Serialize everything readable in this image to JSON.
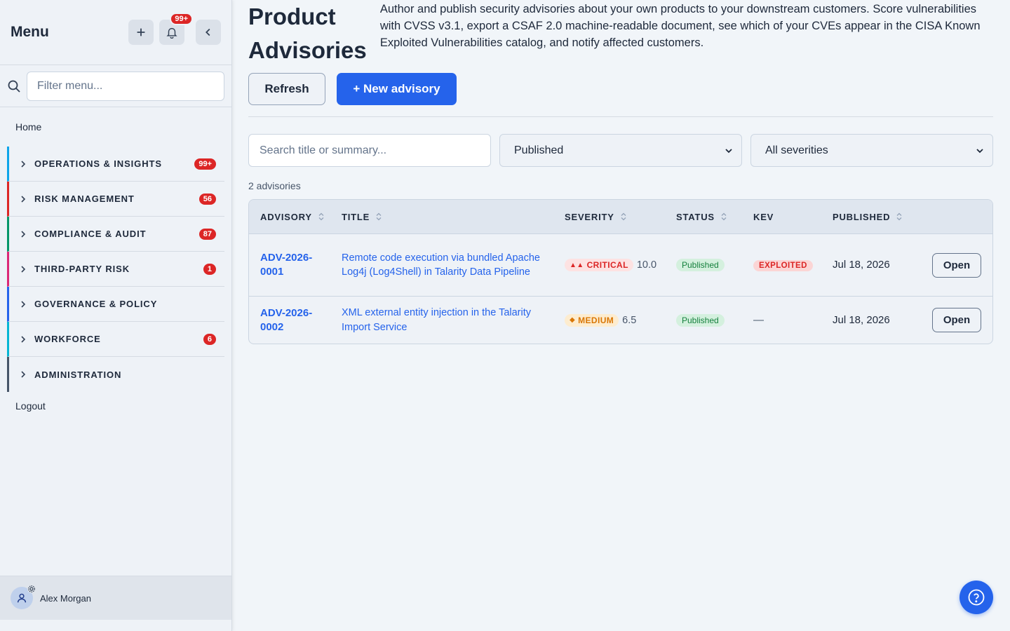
{
  "sidebar": {
    "title": "Menu",
    "notifications_badge": "99+",
    "filter_placeholder": "Filter menu...",
    "home": "Home",
    "groups": [
      {
        "label": "OPERATIONS & INSIGHTS",
        "badge": "99+",
        "color": "#0ea5e9"
      },
      {
        "label": "RISK MANAGEMENT",
        "badge": "56",
        "color": "#dc2626"
      },
      {
        "label": "COMPLIANCE & AUDIT",
        "badge": "87",
        "color": "#059669"
      },
      {
        "label": "THIRD-PARTY RISK",
        "badge": "1",
        "color": "#db2777"
      },
      {
        "label": "GOVERNANCE & POLICY",
        "badge": "",
        "color": "#2563eb"
      },
      {
        "label": "WORKFORCE",
        "badge": "6",
        "color": "#06b6d4"
      },
      {
        "label": "ADMINISTRATION",
        "badge": "",
        "color": "#475569"
      }
    ],
    "logout": "Logout",
    "user_name": "Alex Morgan"
  },
  "page": {
    "title": "Product Advisories",
    "description": "Author and publish security advisories about your own products to your downstream customers. Score vulnerabilities with CVSS v3.1, export a CSAF 2.0 machine-readable document, see which of your CVEs appear in the CISA Known Exploited Vulnerabilities catalog, and notify affected customers.",
    "refresh_label": "Refresh",
    "new_label": "+ New advisory"
  },
  "filters": {
    "search_placeholder": "Search title or summary...",
    "status_value": "Published",
    "severity_value": "All severities"
  },
  "count_label": "2 advisories",
  "table": {
    "headers": [
      "ADVISORY",
      "TITLE",
      "SEVERITY",
      "STATUS",
      "KEV",
      "PUBLISHED"
    ],
    "rows": [
      {
        "id_line1": "ADV-2026-",
        "id_line2": "0001",
        "title": "Remote code execution via bundled Apache Log4j (Log4Shell) in Talarity Data Pipeline",
        "severity": "CRITICAL",
        "score": "10.0",
        "status": "Published",
        "kev": "EXPLOITED",
        "published": "Jul 18, 2026",
        "action": "Open"
      },
      {
        "id_line1": "ADV-2026-",
        "id_line2": "0002",
        "title": "XML external entity injection in the Talarity Import Service",
        "severity": "MEDIUM",
        "score": "6.5",
        "status": "Published",
        "kev": "—",
        "published": "Jul 18, 2026",
        "action": "Open"
      }
    ]
  },
  "colors": {
    "accent": "#2563eb",
    "danger": "#dc2626",
    "success": "#15803d",
    "warning": "#d97706"
  }
}
